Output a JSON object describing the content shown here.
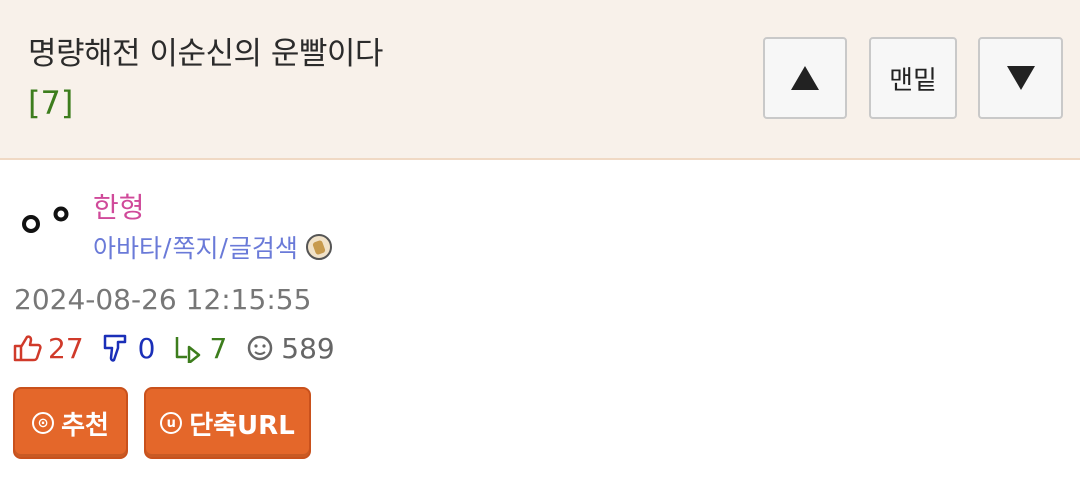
{
  "post": {
    "title": "명량해전 이순신의 운빨이다",
    "comment_count": "[7]",
    "date": "2024-08-26 12:15:55"
  },
  "nav": {
    "up_icon": "triangle-up-icon",
    "bottom_label": "맨밑",
    "down_icon": "triangle-down-icon"
  },
  "author": {
    "nickname": "한형",
    "link_avatar": "아바타",
    "link_message": "쪽지",
    "link_search": "글검색",
    "separator": "/"
  },
  "stats": {
    "upvotes": "27",
    "downvotes": "0",
    "replies": "7",
    "views": "589"
  },
  "actions": {
    "recommend_icon_char": "⊙",
    "recommend_label": "추천",
    "short_url_icon_char": "u",
    "short_url_label": "단축URL"
  },
  "colors": {
    "header_bg": "#f8f1ea",
    "nickname": "#d04a9a",
    "links": "#6a7ad8",
    "upvote": "#d03a2a",
    "downvote": "#1a2fb8",
    "reply": "#3d7d1d",
    "action_button": "#e4672a"
  }
}
